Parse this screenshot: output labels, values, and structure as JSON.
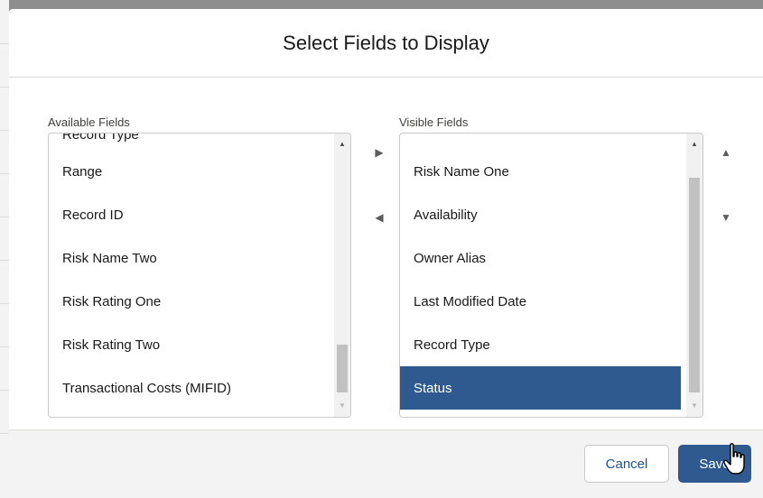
{
  "modal": {
    "title": "Select Fields to Display"
  },
  "available": {
    "label": "Available Fields",
    "partial_item": "Record Type",
    "items": [
      "Range",
      "Record ID",
      "Risk Name Two",
      "Risk Rating One",
      "Risk Rating Two",
      "Transactional Costs (MIFID)"
    ]
  },
  "visible": {
    "label": "Visible Fields",
    "items": [
      "Risk Name One",
      "Availability",
      "Owner Alias",
      "Last Modified Date",
      "Record Type",
      "Status"
    ],
    "selected": "Status"
  },
  "buttons": {
    "cancel": "Cancel",
    "save": "Save"
  },
  "icons": {
    "move_right": "triangle-right-icon",
    "move_left": "triangle-left-icon",
    "move_up": "triangle-up-icon",
    "move_down": "triangle-down-icon",
    "cursor": "hand-pointer-icon"
  },
  "colors": {
    "brand": "#2e5a8f",
    "cancel_text": "#1b5297"
  }
}
